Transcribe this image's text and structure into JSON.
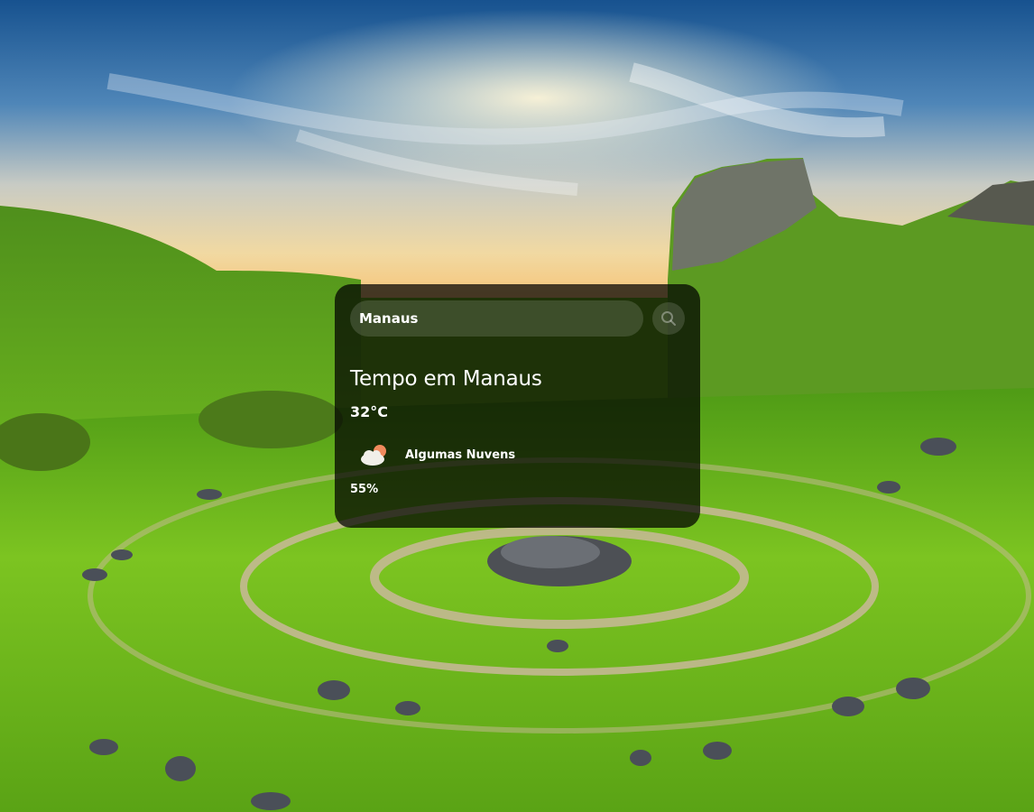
{
  "search": {
    "value": "Manaus",
    "button_icon": "search-icon"
  },
  "weather": {
    "title": "Tempo em Manaus",
    "temperature": "32°C",
    "condition_icon": "partly-cloudy-icon",
    "condition": "Algumas Nuvens",
    "humidity": "55%"
  },
  "colors": {
    "card_background": "#000000b8",
    "text": "#ffffff",
    "grass": "#6bb51e",
    "sky": "#1f5fa6"
  }
}
